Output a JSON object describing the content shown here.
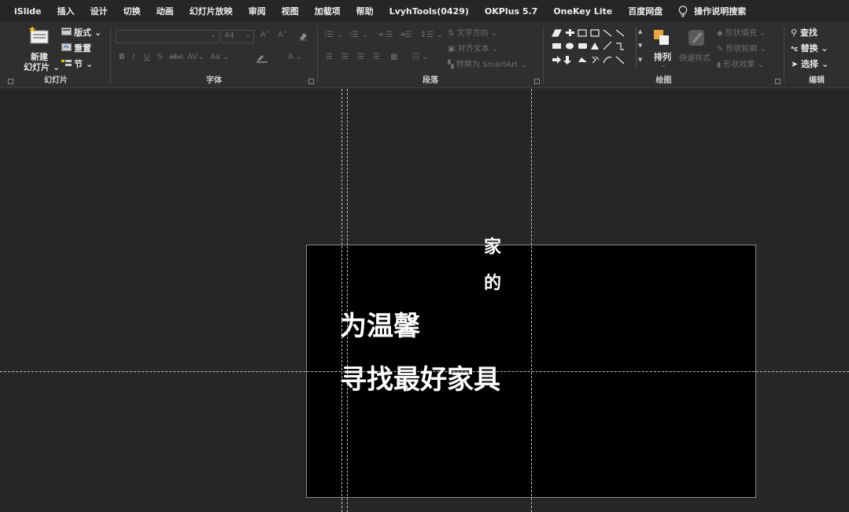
{
  "menubar": {
    "items": [
      "iSlide",
      "插入",
      "设计",
      "切换",
      "动画",
      "幻灯片放映",
      "审阅",
      "视图",
      "加载项",
      "帮助",
      "LvyhTools(0429)",
      "OKPlus 5.7",
      "OneKey Lite",
      "百度网盘"
    ],
    "search_label": "操作说明搜索"
  },
  "ribbon": {
    "slides": {
      "group_label": "幻灯片",
      "new_slide_line1": "新建",
      "new_slide_line2": "幻灯片",
      "layout": "版式",
      "reset": "重置",
      "section": "节"
    },
    "font": {
      "group_label": "字体",
      "font_size": "44",
      "change_case": "Aa"
    },
    "paragraph": {
      "group_label": "段落",
      "text_direction": "文字方向",
      "align_text": "对齐文本",
      "convert_smartart": "转换为 SmartArt"
    },
    "drawing": {
      "group_label": "绘图",
      "arrange": "排列",
      "quick_styles": "快速样式",
      "shape_fill": "形状填充",
      "shape_outline": "形状轮廓",
      "shape_effects": "形状效果"
    },
    "editing": {
      "group_label": "编辑",
      "find": "查找",
      "replace": "替换",
      "select": "选择"
    }
  },
  "slide": {
    "vertical_chars": [
      "家",
      "的"
    ],
    "line1": "为温馨",
    "line2": "寻找最好家具"
  }
}
